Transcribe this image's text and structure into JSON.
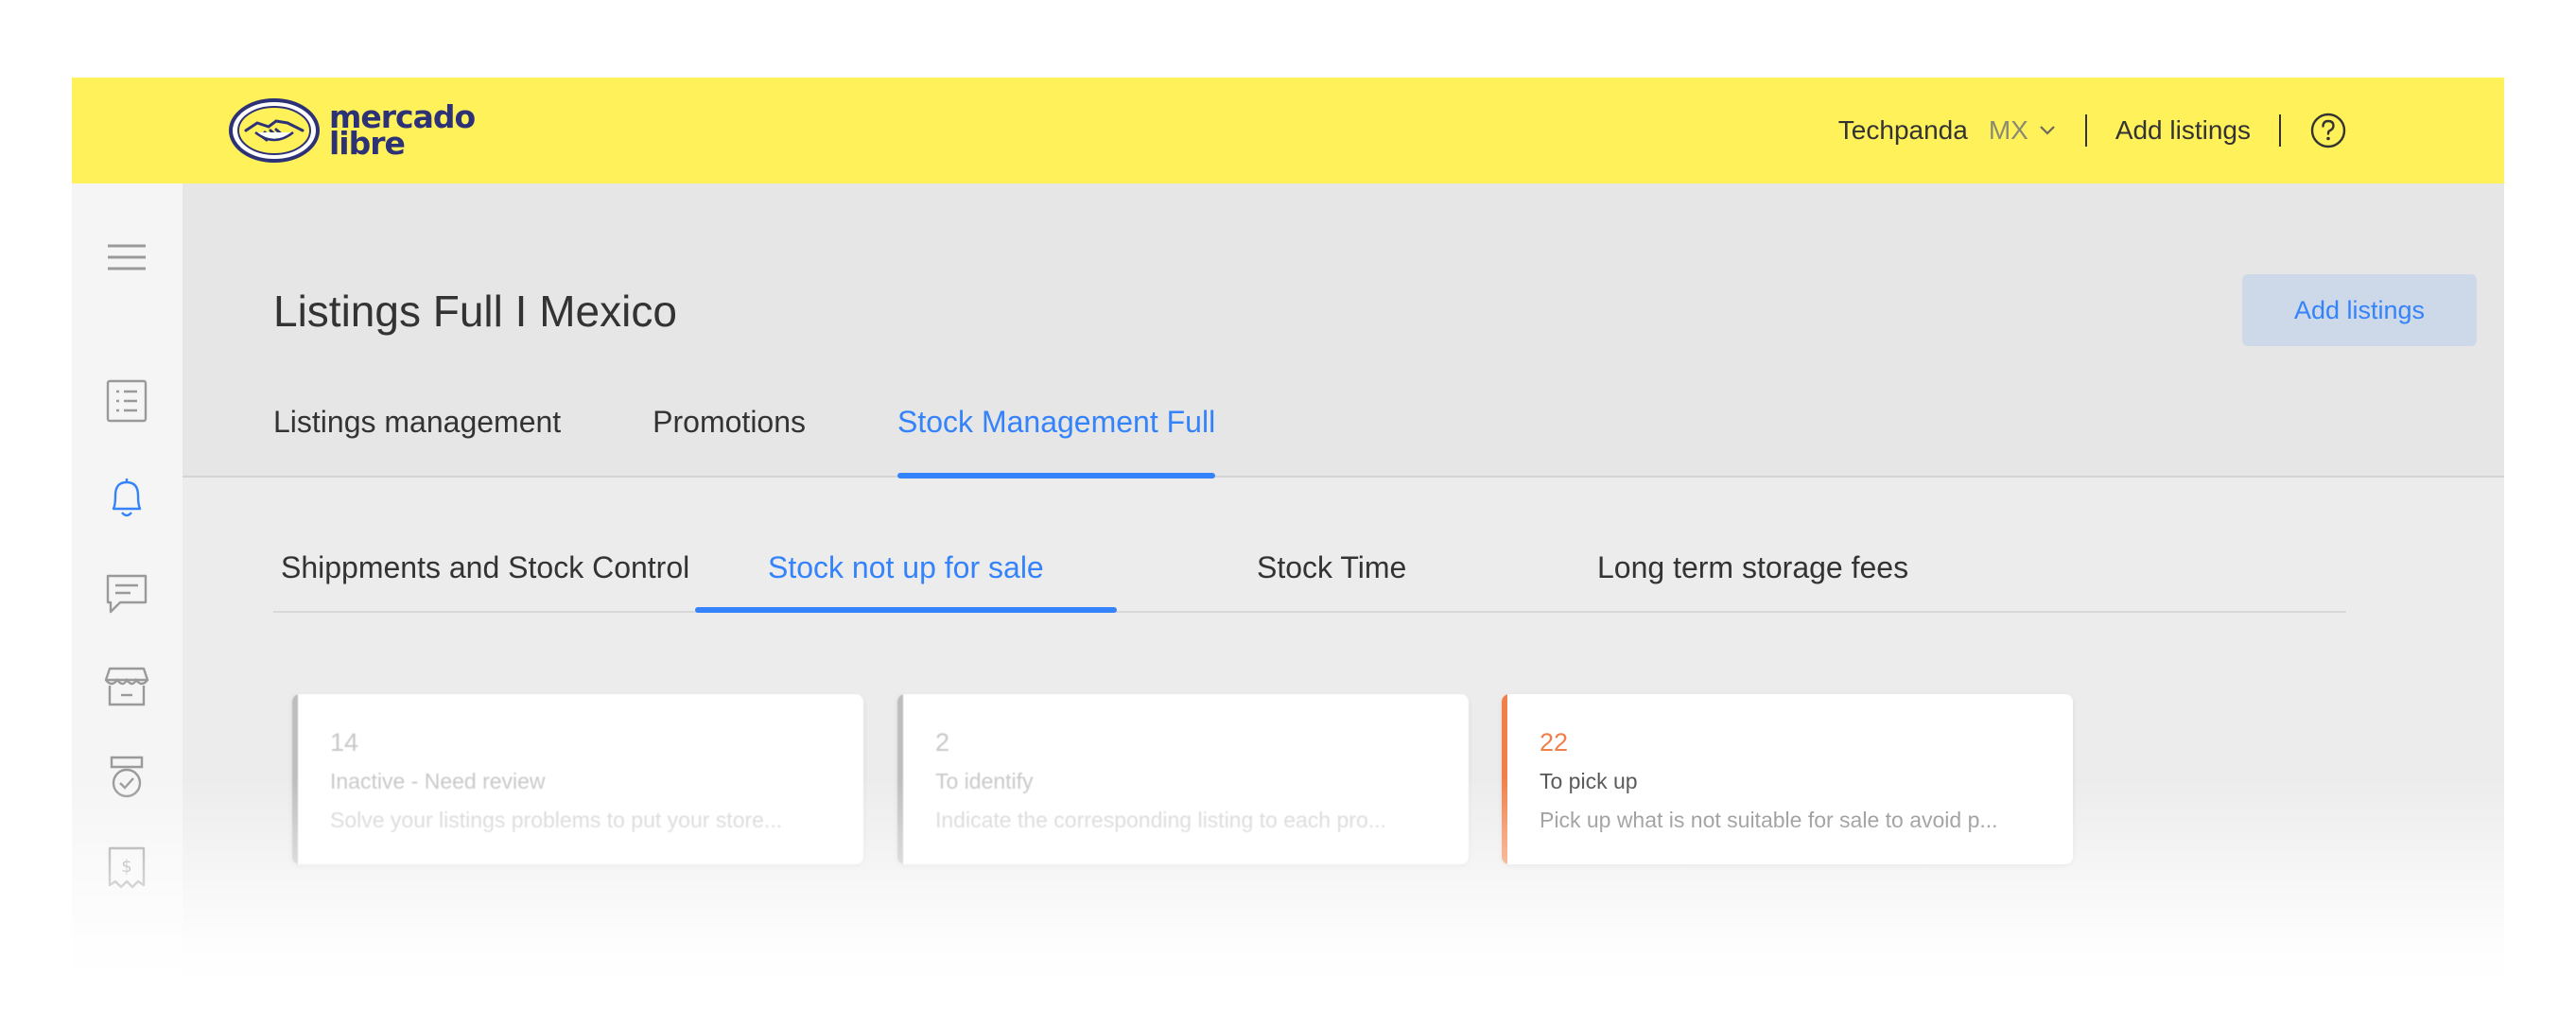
{
  "brand": {
    "line1": "mercado",
    "line2": "libre"
  },
  "topbar": {
    "user_name": "Techpanda",
    "country": "MX",
    "add_listings": "Add listings"
  },
  "page": {
    "title": "Listings Full I Mexico",
    "add_button": "Add listings"
  },
  "main_tabs": [
    {
      "label": "Listings management",
      "active": false
    },
    {
      "label": "Promotions",
      "active": false
    },
    {
      "label": "Stock Management Full",
      "active": true
    }
  ],
  "sub_tabs": [
    {
      "label": "Shippments and Stock Control",
      "active": false
    },
    {
      "label": "Stock not up for sale",
      "active": true
    },
    {
      "label": "Stock Time",
      "active": false
    },
    {
      "label": "Long term storage fees",
      "active": false
    }
  ],
  "cards": [
    {
      "count": "14",
      "title": "Inactive - Need review",
      "description": "Solve your listings problems to put your store..."
    },
    {
      "count": "2",
      "title": "To identify",
      "description": "Indicate the corresponding listing to each pro..."
    },
    {
      "count": "22",
      "title": "To pick up",
      "description": "Pick up what is not suitable for sale to avoid p..."
    }
  ],
  "colors": {
    "brand_yellow": "#fff159",
    "brand_navy": "#2d3277",
    "accent_blue": "#3483fa",
    "alert_orange": "#f0804a"
  },
  "icons": {
    "sidebar": [
      "menu-icon",
      "list-icon",
      "bell-icon",
      "chat-icon",
      "store-icon",
      "badge-icon",
      "receipt-icon"
    ],
    "topbar": [
      "chevron-down-icon",
      "help-icon"
    ]
  }
}
